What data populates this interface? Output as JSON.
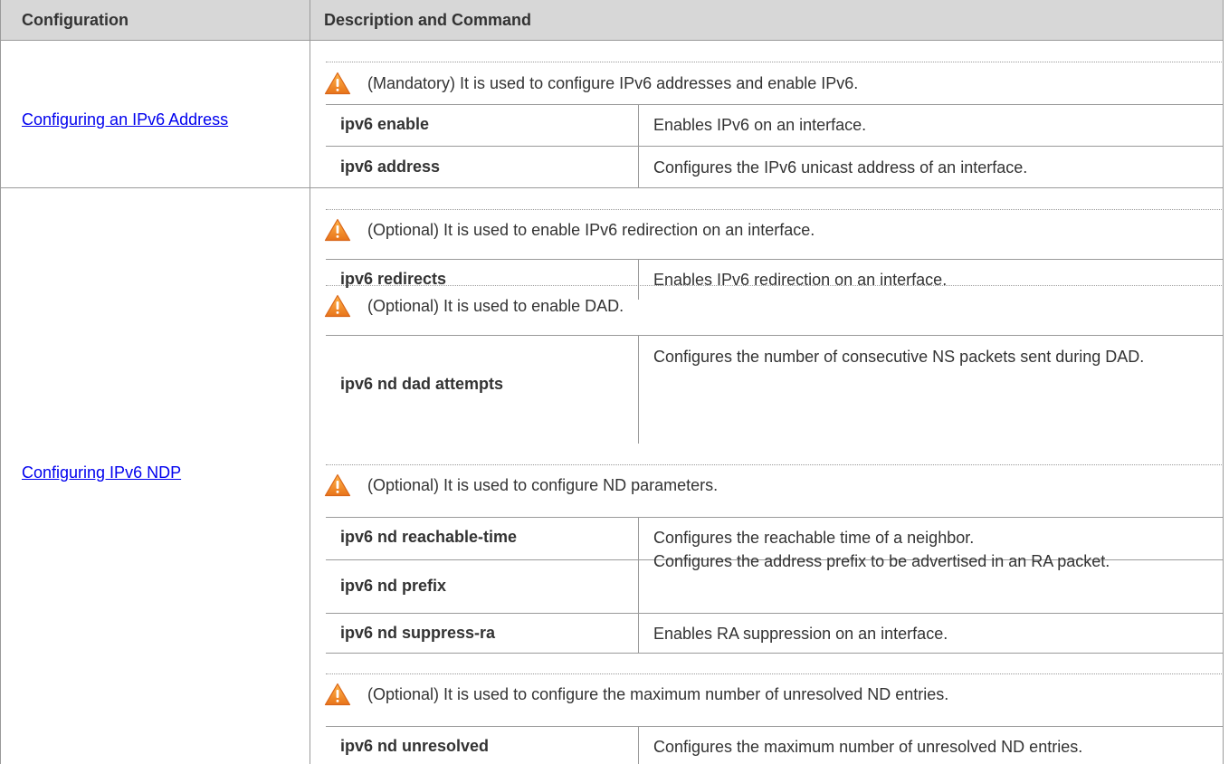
{
  "header": {
    "col1": "Configuration",
    "col2": "Description and Command"
  },
  "sections": [
    {
      "link": "Configuring an IPv6 Address",
      "note": "(Mandatory) It is used to configure IPv6 addresses and enable IPv6.",
      "rows": [
        {
          "command": "ipv6 enable",
          "description": "Enables IPv6 on an interface."
        },
        {
          "command": "ipv6 address",
          "description": "Configures the IPv6 unicast address of an interface."
        }
      ]
    },
    {
      "link": "Configuring IPv6 NDP",
      "groups": [
        {
          "note": "(Optional) It is used to enable IPv6 redirection on an interface.",
          "rows": [
            {
              "command": "ipv6 redirects",
              "description": "Enables IPv6 redirection on an interface."
            }
          ]
        },
        {
          "note": "(Optional) It is used to enable DAD.",
          "rows": [
            {
              "command": "ipv6 nd dad attempts",
              "description": "Configures the number of consecutive NS packets sent during DAD."
            }
          ]
        },
        {
          "note": "(Optional) It is used to configure ND parameters.",
          "rows": [
            {
              "command": "ipv6 nd reachable-time",
              "description": "Configures the reachable time of a neighbor."
            },
            {
              "command": "ipv6 nd prefix",
              "description": "Configures the address prefix to be advertised in an RA packet."
            },
            {
              "command": "ipv6 nd suppress-ra",
              "description": "Enables RA suppression on an interface."
            }
          ]
        },
        {
          "note": "(Optional) It is used to configure the maximum number of unresolved ND entries.",
          "rows": [
            {
              "command": "ipv6 nd unresolved",
              "description": "Configures the maximum number of unresolved ND entries."
            }
          ]
        }
      ]
    }
  ],
  "icon": "warning-triangle-icon",
  "colors": {
    "header_bg": "#d7d7d7",
    "link": "#0000ee",
    "warning": "#f39a1e"
  }
}
